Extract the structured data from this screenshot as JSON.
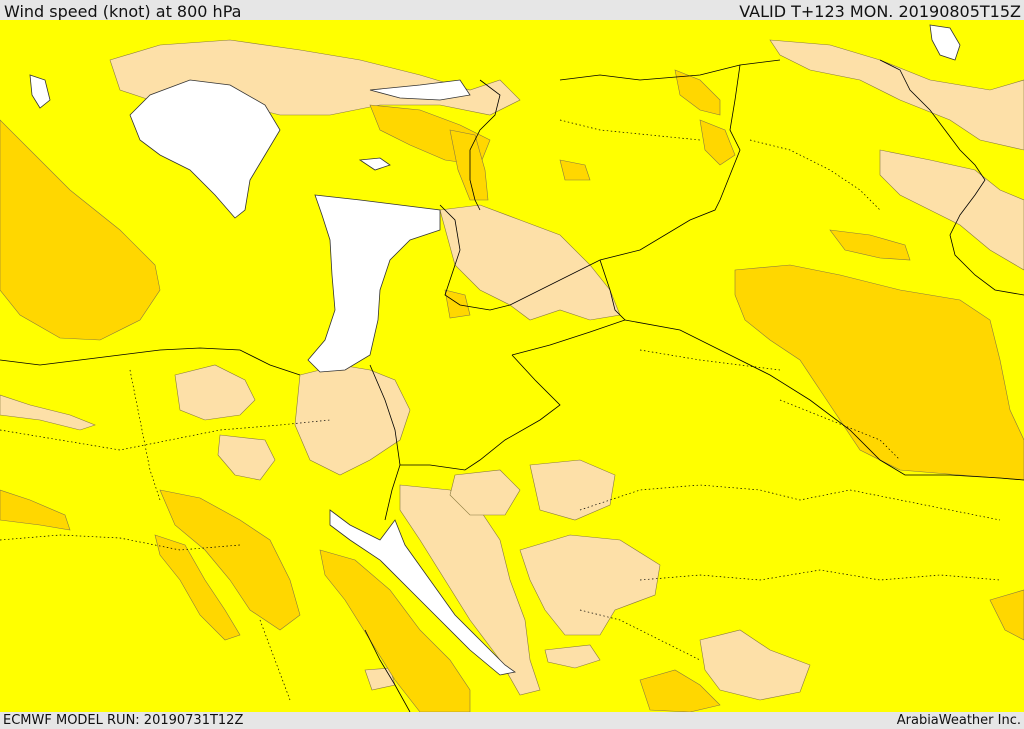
{
  "header": {
    "title": "Wind speed (knot) at 800 hPa",
    "valid": "VALID T+123 MON. 20190805T15Z"
  },
  "footer": {
    "model_run": "ECMWF MODEL RUN: 20190731T12Z",
    "brand": "ArabiaWeather Inc."
  },
  "colors": {
    "background_band": "#ffff00",
    "low_band": "#fde0a8",
    "high_band": "#ffd700",
    "water_mask": "#ffffff",
    "border": "#000000"
  }
}
